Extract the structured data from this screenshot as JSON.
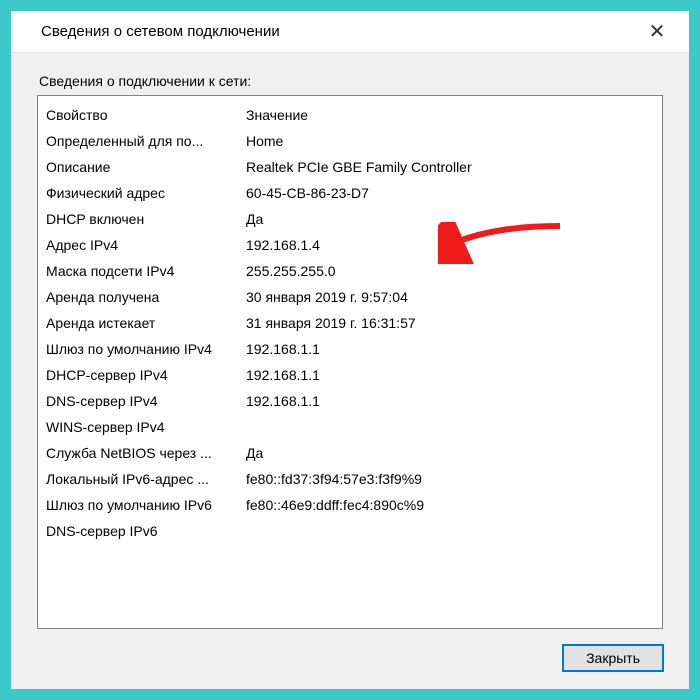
{
  "dialog": {
    "title": "Сведения о сетевом подключении",
    "subtitle": "Сведения о подключении к сети:",
    "close_label": "Закрыть"
  },
  "headers": {
    "property": "Свойство",
    "value": "Значение"
  },
  "rows": [
    {
      "prop": "Определенный для по...",
      "val": "Home"
    },
    {
      "prop": "Описание",
      "val": "Realtek PCIe GBE Family Controller"
    },
    {
      "prop": "Физический адрес",
      "val": "60-45-CB-86-23-D7"
    },
    {
      "prop": "DHCP включен",
      "val": "Да"
    },
    {
      "prop": "Адрес IPv4",
      "val": "192.168.1.4"
    },
    {
      "prop": "Маска подсети IPv4",
      "val": "255.255.255.0"
    },
    {
      "prop": "Аренда получена",
      "val": "30 января 2019 г. 9:57:04"
    },
    {
      "prop": "Аренда истекает",
      "val": "31 января 2019 г. 16:31:57"
    },
    {
      "prop": "Шлюз по умолчанию IPv4",
      "val": "192.168.1.1"
    },
    {
      "prop": "DHCP-сервер IPv4",
      "val": "192.168.1.1"
    },
    {
      "prop": "DNS-сервер IPv4",
      "val": "192.168.1.1"
    },
    {
      "prop": "WINS-сервер IPv4",
      "val": ""
    },
    {
      "prop": "Служба NetBIOS через ...",
      "val": "Да"
    },
    {
      "prop": "Локальный IPv6-адрес ...",
      "val": "fe80::fd37:3f94:57e3:f3f9%9"
    },
    {
      "prop": "Шлюз по умолчанию IPv6",
      "val": "fe80::46e9:ddff:fec4:890c%9"
    },
    {
      "prop": "DNS-сервер IPv6",
      "val": ""
    }
  ]
}
